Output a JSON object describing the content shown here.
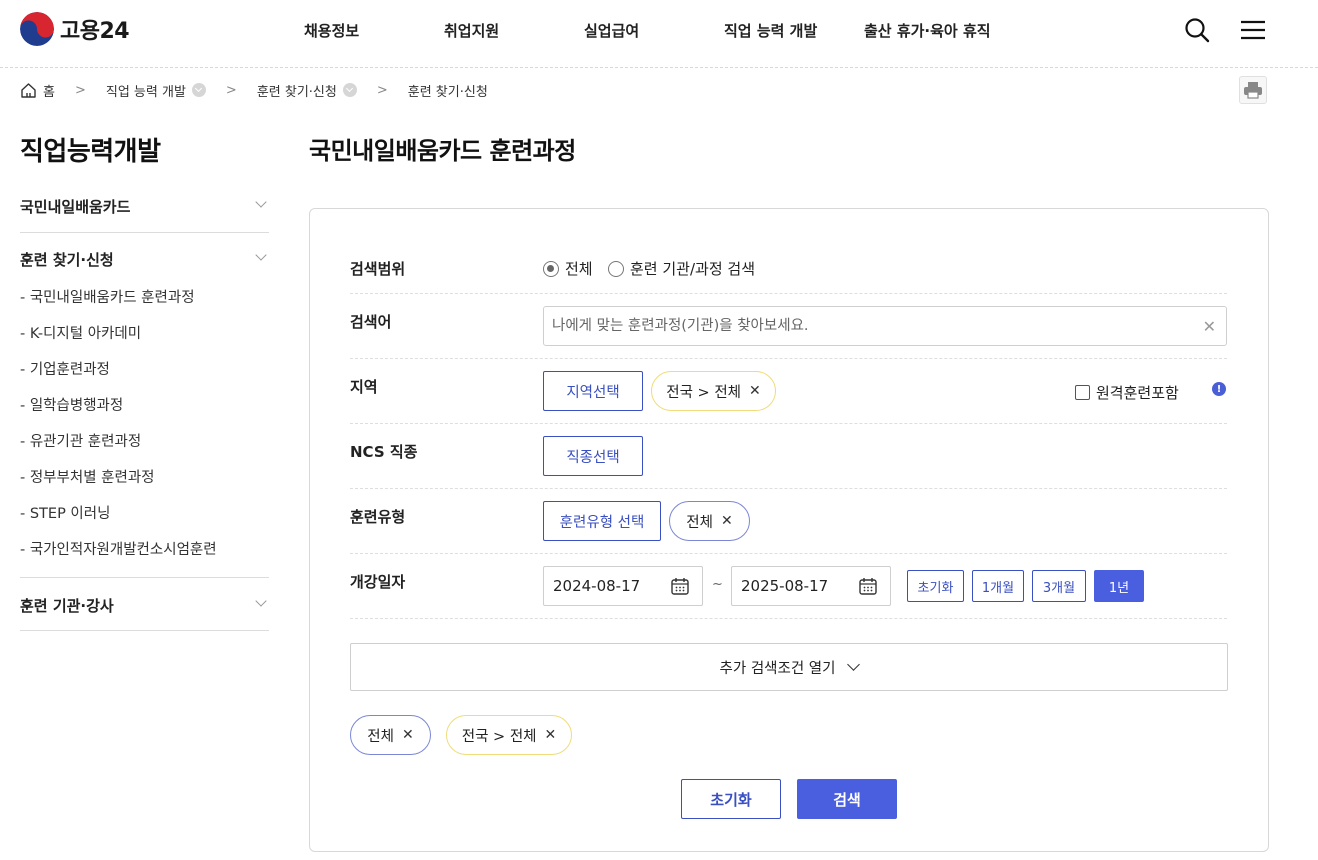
{
  "header": {
    "logo_text": "고용24",
    "nav": [
      "채용정보",
      "취업지원",
      "실업급여",
      "직업 능력 개발",
      "출산 휴가·육아 휴직"
    ]
  },
  "breadcrumb": {
    "home": "홈",
    "items": [
      "직업 능력 개발",
      "훈련 찾기·신청",
      "훈련 찾기·신청"
    ]
  },
  "sidebar": {
    "title": "직업능력개발",
    "sections": [
      "국민내일배움카드",
      "훈련 찾기·신청",
      "훈련 기관·강사"
    ],
    "items": [
      "- 국민내일배움카드 훈련과정",
      "- K-디지털 아카데미",
      "- 기업훈련과정",
      "- 일학습병행과정",
      "- 유관기관 훈련과정",
      "- 정부부처별 훈련과정",
      "- STEP 이러닝",
      "- 국가인적자원개발컨소시엄훈련"
    ]
  },
  "main": {
    "title": "국민내일배움카드 훈련과정",
    "form": {
      "scope": {
        "label": "검색범위",
        "options": [
          "전체",
          "훈련 기관/과정 검색"
        ],
        "selected": "전체"
      },
      "keyword": {
        "label": "검색어",
        "value": "",
        "placeholder": "나에게 맞는 훈련과정(기관)을 찾아보세요."
      },
      "region": {
        "label": "지역",
        "button": "지역선택",
        "chip": "전국 > 전체",
        "remote_label": "원격훈련포함",
        "remote_checked": false
      },
      "ncs": {
        "label": "NCS 직종",
        "button": "직종선택"
      },
      "training_type": {
        "label": "훈련유형",
        "button": "훈련유형 선택",
        "chip": "전체"
      },
      "start_date": {
        "label": "개강일자",
        "from": "2024-08-17",
        "to": "2025-08-17",
        "separator": "~",
        "periods": [
          "초기화",
          "1개월",
          "3개월",
          "1년"
        ],
        "active_period": "1년"
      }
    },
    "more_conditions": "추가 검색조건 열기",
    "selected_chips": [
      "전체",
      "전국 > 전체"
    ],
    "actions": {
      "reset": "초기화",
      "search": "검색"
    }
  },
  "colors": {
    "accent": "#4a5ee0",
    "outline": "#3a4fc0",
    "chip_yellow": "#f0dc7a",
    "chip_blue": "#7b87d6"
  }
}
